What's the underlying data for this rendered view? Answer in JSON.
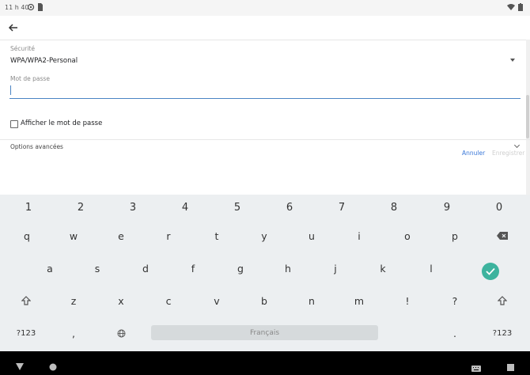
{
  "status_bar": {
    "time": "11 h 40",
    "icons": [
      "sync-icon",
      "sim-card-icon",
      "wifi-icon",
      "battery-icon"
    ]
  },
  "app_bar": {
    "back_icon": "arrow-left-icon"
  },
  "form": {
    "security_label": "Sécurité",
    "security_value": "WPA/WPA2-Personal",
    "password_label": "Mot de passe",
    "password_value": "",
    "show_password_label": "Afficher le mot de passe",
    "advanced_label": "Options avancées",
    "cancel_label": "Annuler",
    "save_label": "Enregistrer"
  },
  "keyboard": {
    "row_numbers": [
      "1",
      "2",
      "3",
      "4",
      "5",
      "6",
      "7",
      "8",
      "9",
      "0"
    ],
    "row1": [
      "q",
      "w",
      "e",
      "r",
      "t",
      "y",
      "u",
      "i",
      "o",
      "p"
    ],
    "row2": [
      "a",
      "s",
      "d",
      "f",
      "g",
      "h",
      "j",
      "k",
      "l"
    ],
    "row3": [
      "z",
      "x",
      "c",
      "v",
      "b",
      "n",
      "m",
      "!",
      "?"
    ],
    "symbols_label": "?123",
    "comma": ",",
    "period": ".",
    "space_label": "Français",
    "enter_color": "#3db39e"
  },
  "nav_bar": {
    "icons": [
      "back-triangle-icon",
      "home-circle-icon",
      "keyboard-icon",
      "recents-square-icon"
    ]
  },
  "colors": {
    "accent": "#3b78d8",
    "input_underline": "#4a84c4"
  }
}
